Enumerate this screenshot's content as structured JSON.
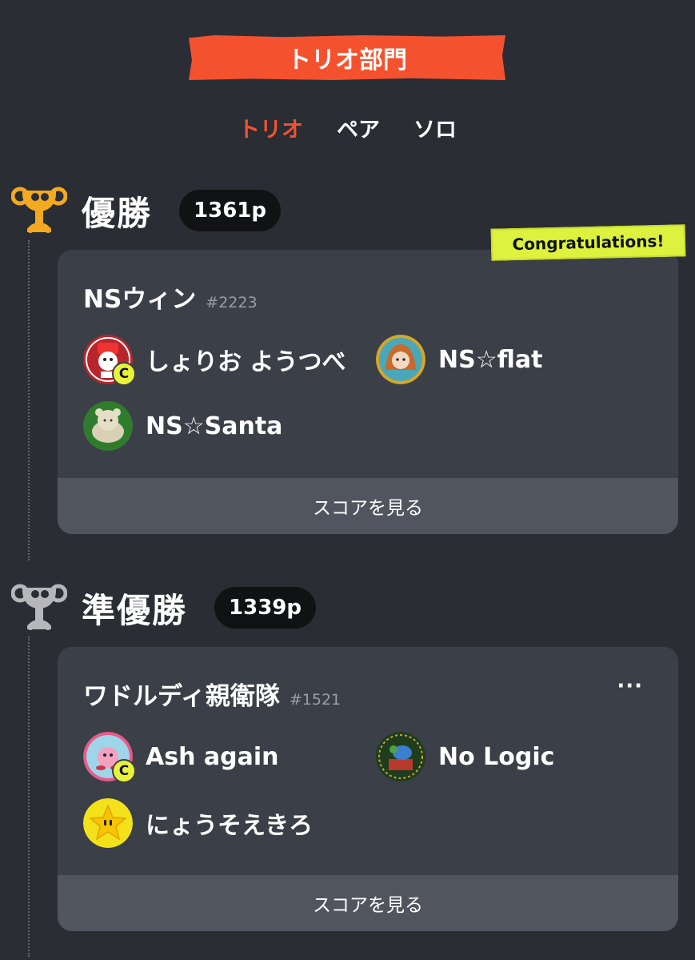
{
  "header": {
    "title": "トリオ部門"
  },
  "tabs": [
    {
      "label": "トリオ",
      "active": true
    },
    {
      "label": "ペア",
      "active": false
    },
    {
      "label": "ソロ",
      "active": false
    }
  ],
  "sections": [
    {
      "rank": "優勝",
      "trophy": "gold-trophy-icon",
      "points": "1361p",
      "badge": "Congratulations!",
      "team": {
        "name": "NSウィン",
        "tag": "#2223"
      },
      "members": [
        {
          "name": "しょりお ようつべ",
          "avatar": "avatar-red-snowman",
          "captain": "C"
        },
        {
          "name": "NS☆flat",
          "avatar": "avatar-anime-girl",
          "captain": ""
        },
        {
          "name": "NS☆Santa",
          "avatar": "avatar-plush-cat",
          "captain": ""
        }
      ],
      "score_button": "スコアを見る"
    },
    {
      "rank": "準優勝",
      "trophy": "silver-trophy-icon",
      "points": "1339p",
      "more_menu": "···",
      "team": {
        "name": "ワドルディ親衛隊",
        "tag": "#1521"
      },
      "members": [
        {
          "name": "Ash again",
          "avatar": "avatar-kirby",
          "captain": "C"
        },
        {
          "name": "No Logic",
          "avatar": "avatar-green-frame",
          "captain": ""
        },
        {
          "name": "にょうそえきろ",
          "avatar": "avatar-star",
          "captain": ""
        }
      ],
      "score_button": "スコアを見る"
    }
  ],
  "colors": {
    "accent": "#f4522f",
    "gold": "#f3a920",
    "silver": "#b5b7ba",
    "congrats": "#dcf23e"
  }
}
